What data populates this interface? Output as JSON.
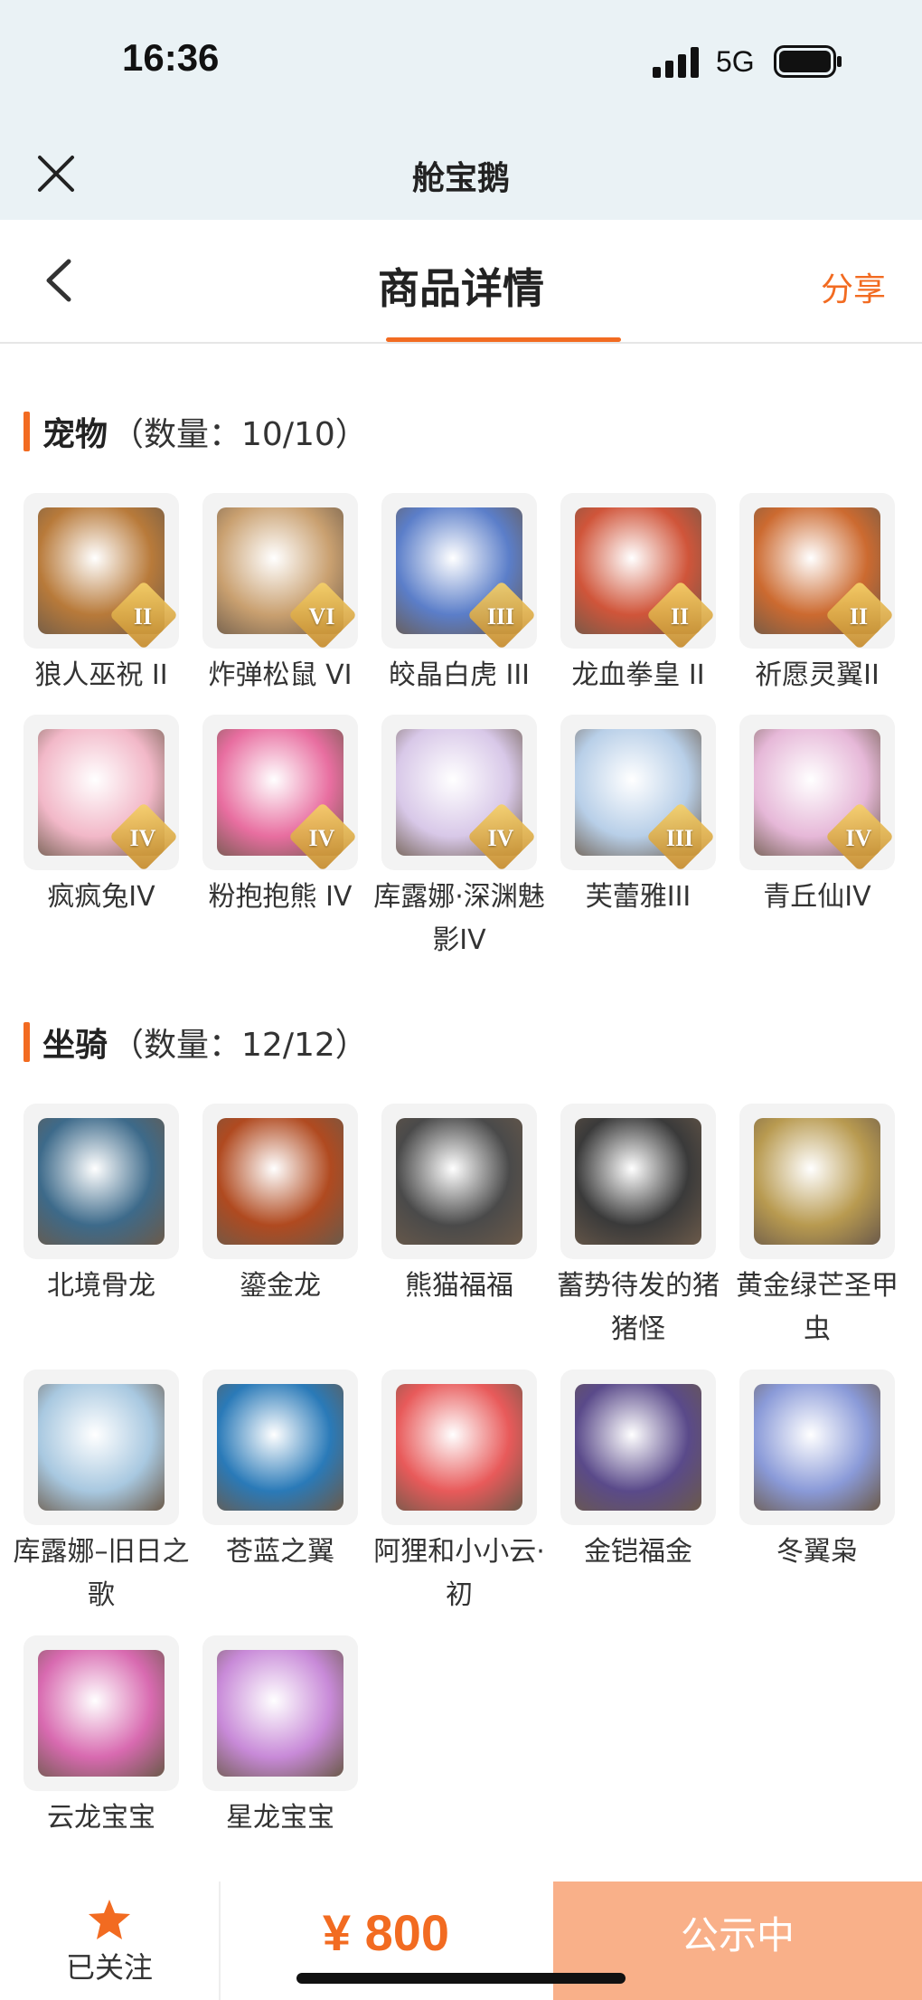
{
  "status_bar": {
    "time": "16:36",
    "network": "5G"
  },
  "webview": {
    "title": "舱宝鹅"
  },
  "nav": {
    "title": "商品详情",
    "share": "分享"
  },
  "pets": {
    "title": "宠物",
    "count": "（数量：10/10）",
    "items": [
      {
        "name": "狼人巫祝 II",
        "grade": "II",
        "color": "#b87a3a"
      },
      {
        "name": "炸弹松鼠 VI",
        "grade": "VI",
        "color": "#c9a070"
      },
      {
        "name": "皎晶白虎 III",
        "grade": "III",
        "color": "#5b7ec9"
      },
      {
        "name": "龙血拳皇 II",
        "grade": "II",
        "color": "#d0553a"
      },
      {
        "name": "祈愿灵翼II",
        "grade": "II",
        "color": "#cc6a30"
      },
      {
        "name": "疯疯兔IV",
        "grade": "IV",
        "color": "#f2b8c8"
      },
      {
        "name": "粉抱抱熊 IV",
        "grade": "IV",
        "color": "#e86ea0"
      },
      {
        "name": "库露娜·深渊魅影IV",
        "grade": "IV",
        "color": "#d8c8e8"
      },
      {
        "name": "芙蕾雅III",
        "grade": "III",
        "color": "#b8cfe8"
      },
      {
        "name": "青丘仙IV",
        "grade": "IV",
        "color": "#e6b8d8"
      }
    ]
  },
  "mounts": {
    "title": "坐骑",
    "count": "（数量：12/12）",
    "items": [
      {
        "name": "北境骨龙",
        "color": "#3d6a8a"
      },
      {
        "name": "鎏金龙",
        "color": "#b04a20"
      },
      {
        "name": "熊猫福福",
        "color": "#4a4a4a"
      },
      {
        "name": "蓄势待发的猪猪怪",
        "color": "#3a3a3a"
      },
      {
        "name": "黄金绿芒圣甲虫",
        "color": "#b89a50"
      },
      {
        "name": "库露娜–旧日之歌",
        "color": "#a8c8e0"
      },
      {
        "name": "苍蓝之翼",
        "color": "#2a7ab8"
      },
      {
        "name": "阿狸和小小云·初",
        "color": "#e85a5a"
      },
      {
        "name": "金铠福金",
        "color": "#5a4a8a"
      },
      {
        "name": "冬翼枭",
        "color": "#8a9ad8"
      },
      {
        "name": "云龙宝宝",
        "color": "#d86ab0"
      },
      {
        "name": "星龙宝宝",
        "color": "#c88ad8"
      }
    ]
  },
  "bottom_bar": {
    "follow_label": "已关注",
    "price": "¥ 800",
    "status_button": "公示中"
  },
  "colors": {
    "accent": "#f26b21",
    "status_button_bg": "#f9b089"
  }
}
